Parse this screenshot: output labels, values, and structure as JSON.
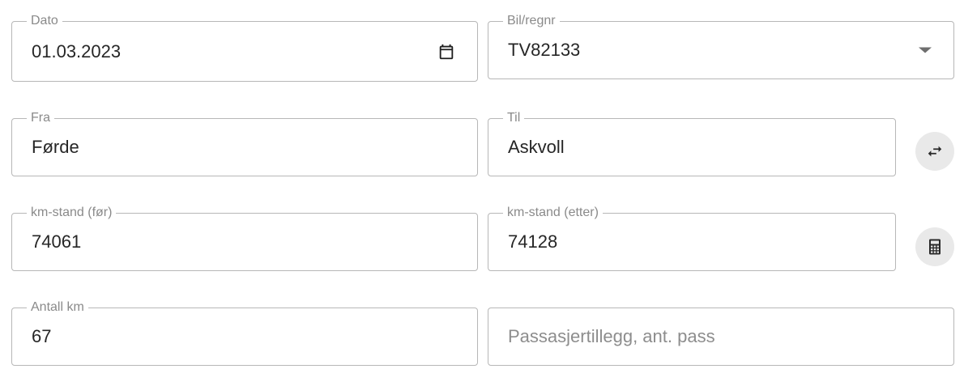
{
  "form": {
    "date": {
      "label": "Dato",
      "value": "01.03.2023"
    },
    "car": {
      "label": "Bil/regnr",
      "value": "TV82133"
    },
    "from": {
      "label": "Fra",
      "value": "Førde"
    },
    "to": {
      "label": "Til",
      "value": "Askvoll"
    },
    "odometer_before": {
      "label": "km-stand (før)",
      "value": "74061"
    },
    "odometer_after": {
      "label": "km-stand (etter)",
      "value": "74128"
    },
    "total_km": {
      "label": "Antall km",
      "value": "67"
    },
    "passengers": {
      "placeholder": "Passasjertillegg, ant. pass"
    }
  },
  "icons": {
    "date": "calendar-icon",
    "car": "dropdown-arrow-icon",
    "swap": "swap-icon",
    "calculate": "calculator-icon"
  }
}
